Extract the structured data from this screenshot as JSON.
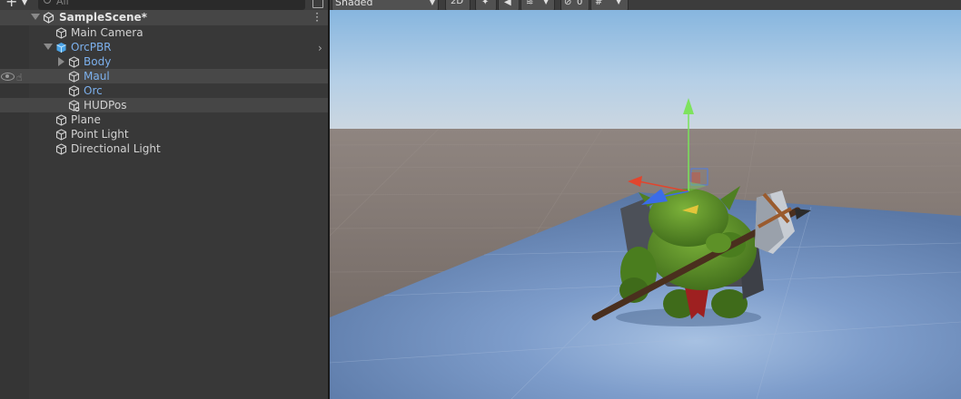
{
  "hierarchy": {
    "search_placeholder": "All",
    "scene_name": "SampleScene*",
    "items": [
      {
        "label": "Main Camera"
      },
      {
        "label": "OrcPBR"
      },
      {
        "label": "Body"
      },
      {
        "label": "Maul"
      },
      {
        "label": "Orc"
      },
      {
        "label": "HUDPos"
      },
      {
        "label": "Plane"
      },
      {
        "label": "Point Light"
      },
      {
        "label": "Directional Light"
      }
    ]
  },
  "scene_view": {
    "shading_mode": "Shaded",
    "mode_2d_label": "2D",
    "hidden_count": "0"
  },
  "colors": {
    "prefab_blue": "#7cb0ec",
    "panel_bg": "#383838",
    "sky_top": "#8db9e0",
    "ground": "#7a6f6a",
    "plane_blue": "#6f8fbd",
    "gizmo_y": "#79e35a",
    "gizmo_x": "#e2452d",
    "gizmo_z": "#3b6ce8"
  }
}
